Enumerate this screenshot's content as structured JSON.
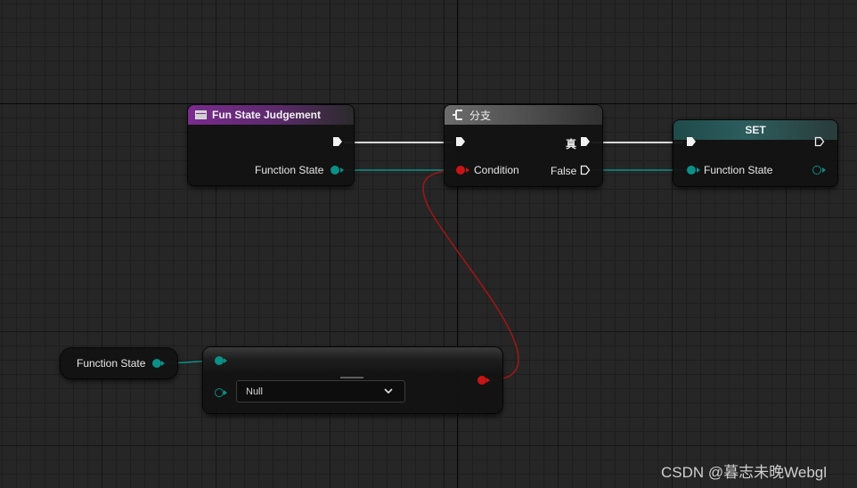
{
  "nodes": {
    "func_entry": {
      "title": "Fun State Judgement",
      "output_label": "Function State"
    },
    "branch": {
      "title": "分支",
      "input_label": "Condition",
      "true_label": "真",
      "false_label": "False"
    },
    "set": {
      "title": "SET",
      "input_label": "Function State"
    },
    "getter": {
      "label": "Function State"
    },
    "equal": {
      "dropdown_value": "Null"
    }
  },
  "colors": {
    "exec_wire": "#d9d9d9",
    "enum_wire": "#0c8f86",
    "bool_wire": "#b01818",
    "function_header": "#7a2b8f",
    "set_header": "#2d5d5d"
  },
  "icons": [
    "function-icon",
    "branch-icon",
    "chevron-down-icon"
  ],
  "watermark": "CSDN @暮志未晚Webgl"
}
